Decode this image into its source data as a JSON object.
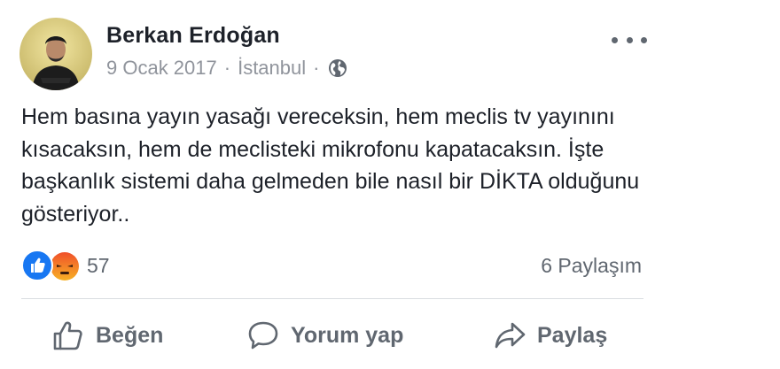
{
  "post": {
    "author": "Berkan Erdoğan",
    "date": "9 Ocak 2017",
    "separator": "·",
    "location": "İstanbul",
    "text": "Hem basına yayın yasağı vereceksin, hem meclis tv yayınını kısacaksın, hem de meclisteki mikrofonu kapatacaksın. İşte başkanlık sistemi daha gelmeden bile nasıl bir DİKTA olduğunu gösteriyor..",
    "reaction_count": "57",
    "share_count": "6 Paylaşım"
  },
  "actions": {
    "like": "Beğen",
    "comment": "Yorum yap",
    "share": "Paylaş"
  },
  "icons": {
    "privacy": "globe-icon",
    "menu": "more-icon",
    "reaction_1": "like-reaction-icon",
    "reaction_2": "angry-reaction-icon"
  },
  "colors": {
    "like_blue": "#1877f2",
    "angry_orange": "#e9710f",
    "text": "#1d2129",
    "secondary": "#90949c"
  }
}
